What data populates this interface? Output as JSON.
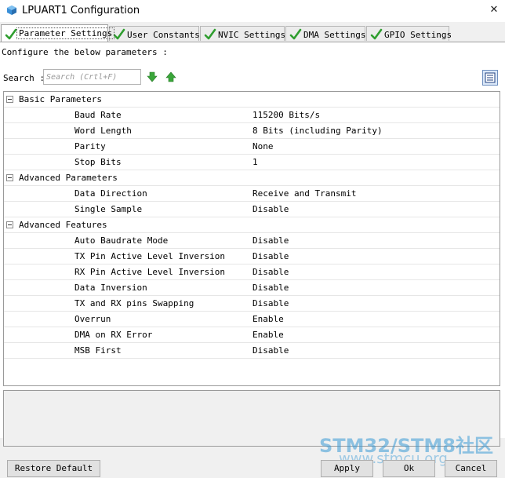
{
  "window": {
    "title": "LPUART1 Configuration",
    "close_glyph": "✕"
  },
  "tabs": [
    {
      "label": "Parameter Settings",
      "active": true
    },
    {
      "label": "User Constants",
      "active": false
    },
    {
      "label": "NVIC Settings",
      "active": false
    },
    {
      "label": "DMA Settings",
      "active": false
    },
    {
      "label": "GPIO Settings",
      "active": false
    }
  ],
  "configure_text": "Configure the below parameters :",
  "search": {
    "label": "Search :",
    "placeholder": "Search (Crtl+F)"
  },
  "icons": {
    "app": "cube-icon",
    "tab_status": "checkmark-icon",
    "search_down": "arrow-down-icon",
    "search_up": "arrow-up-icon",
    "view_toggle": "list-view-icon",
    "group_toggle": "collapse-icon"
  },
  "colors": {
    "check_green": "#2f9e2f",
    "arrow_green": "#3aa63a",
    "app_icon_blue": "#3a8fd8",
    "watermark_blue": "#3b9bd6"
  },
  "groups": [
    {
      "name": "Basic Parameters",
      "params": [
        {
          "name": "Baud Rate",
          "value": "115200 Bits/s"
        },
        {
          "name": "Word Length",
          "value": "8 Bits (including Parity)"
        },
        {
          "name": "Parity",
          "value": "None"
        },
        {
          "name": "Stop Bits",
          "value": "1"
        }
      ]
    },
    {
      "name": "Advanced Parameters",
      "params": [
        {
          "name": "Data Direction",
          "value": "Receive and Transmit"
        },
        {
          "name": "Single Sample",
          "value": "Disable"
        }
      ]
    },
    {
      "name": "Advanced Features",
      "params": [
        {
          "name": "Auto Baudrate Mode",
          "value": "Disable"
        },
        {
          "name": "TX Pin Active Level Inversion",
          "value": "Disable"
        },
        {
          "name": "RX Pin Active Level Inversion",
          "value": "Disable"
        },
        {
          "name": "Data Inversion",
          "value": "Disable"
        },
        {
          "name": "TX and RX pins Swapping",
          "value": "Disable"
        },
        {
          "name": "Overrun",
          "value": "Enable"
        },
        {
          "name": "DMA on RX Error",
          "value": "Enable"
        },
        {
          "name": "MSB First",
          "value": "Disable"
        }
      ]
    }
  ],
  "buttons": {
    "restore": "Restore Default",
    "apply": "Apply",
    "ok": "Ok",
    "cancel": "Cancel"
  },
  "watermark": {
    "line1": "STM32/STM8社区",
    "line2": "www.stmcu.org"
  }
}
